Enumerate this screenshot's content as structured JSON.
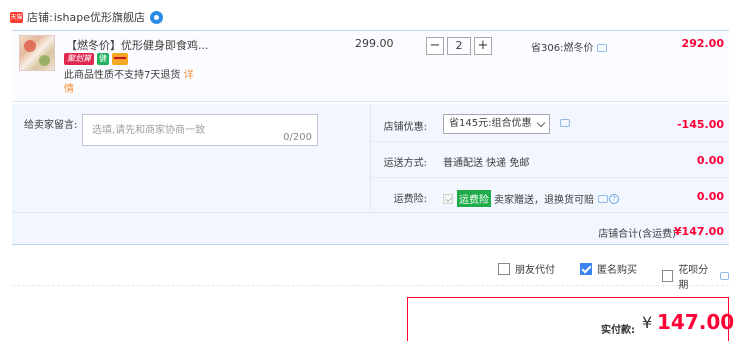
{
  "shop": {
    "logo_text": "天猫",
    "prefix": "店铺:",
    "name": "ishape优形旗舰店"
  },
  "item": {
    "title": "【燃冬价】优形健身即食鸡...",
    "badge_juhuasuan": "聚划算",
    "badge_green": "健",
    "no_return_text": "此商品性质不支持7天退货",
    "no_return_link": "详情",
    "unit_price": "299.00",
    "quantity": "2",
    "qty_minus": "−",
    "qty_plus": "+",
    "save_text": "省306:燃冬价",
    "total": "292.00"
  },
  "memo": {
    "label": "给卖家留言:",
    "placeholder": "选填,请先和商家协商一致",
    "count": "0/200"
  },
  "discount": {
    "label": "店铺优惠:",
    "selected": "省145元:组合优惠",
    "amount": "-145.00"
  },
  "shipping": {
    "label": "运送方式:",
    "value": "普通配送 快递 免邮",
    "amount": "0.00"
  },
  "insurance": {
    "label": "运费险:",
    "tag": "运费险",
    "value": "卖家赠送，退换货可赔",
    "help": "?",
    "amount": "0.00"
  },
  "shop_total": {
    "label": "店铺合计(含运费)",
    "amount": "¥147.00"
  },
  "options": {
    "friend_pay": "朋友代付",
    "anonymous": "匿名购买",
    "installment": "花呗分期"
  },
  "payment": {
    "label": "实付款:",
    "currency": "¥",
    "amount": "147.00"
  },
  "colors": {
    "accent_red": "#ff0036",
    "checkbox_blue": "#3a83f1",
    "insurance_green": "#1dac49"
  }
}
